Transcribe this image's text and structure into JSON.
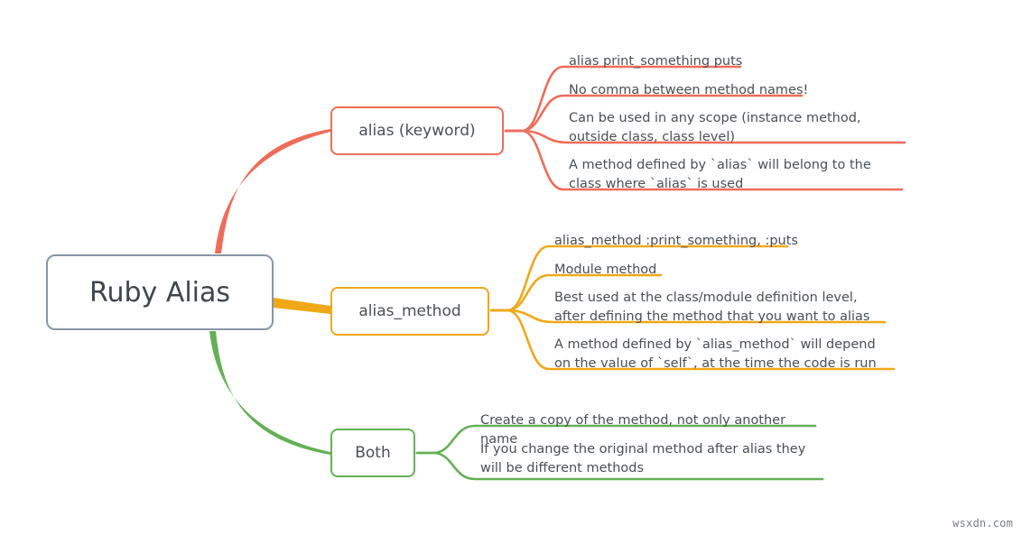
{
  "diagram": {
    "type": "mind-map",
    "root": {
      "label": "Ruby Alias",
      "color": "#8795a6"
    },
    "watermark": "wsxdn.com",
    "branches": [
      {
        "id": "alias-keyword",
        "label": "alias (keyword)",
        "color": "#ef6c5a",
        "leaves": [
          {
            "text": "alias print_something puts"
          },
          {
            "text": "No comma between method names!"
          },
          {
            "text": "Can be used in any scope (instance method, outside class, class level)"
          },
          {
            "text": "A method defined by `alias` will belong to the class where `alias` is used"
          }
        ]
      },
      {
        "id": "alias-method",
        "label": "alias_method",
        "color": "#f0a818",
        "leaves": [
          {
            "text": "alias_method :print_something, :puts"
          },
          {
            "text": "Module method"
          },
          {
            "text": "Best used at the class/module definition level, after defining the method that you want to alias"
          },
          {
            "text": "A method defined by `alias_method` will depend on the value of `self`, at the time the code is run"
          }
        ]
      },
      {
        "id": "both",
        "label": "Both",
        "color": "#64b054",
        "leaves": [
          {
            "text": "Create a copy of the method, not only another name"
          },
          {
            "text": "If you change the original method after alias they will be different methods"
          }
        ]
      }
    ]
  }
}
